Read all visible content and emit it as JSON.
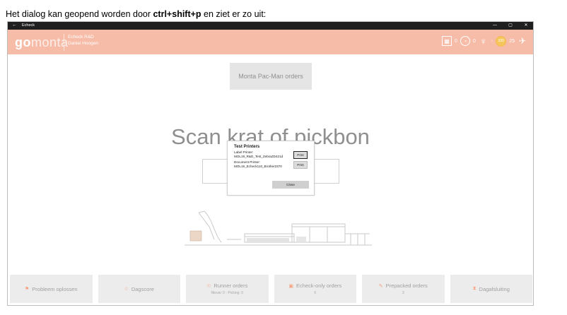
{
  "caption": {
    "prefix": "Het dialog kan geopend worden door ",
    "shortcut": "ctrl+shift+p",
    "suffix": " en ziet er zo uit:"
  },
  "window": {
    "title": "Echeck",
    "controls": [
      "—",
      "▢",
      "✕"
    ]
  },
  "header": {
    "logo_go": "go",
    "logo_monta": "monta",
    "company": "Echeck R&D",
    "user": "Daniel Hoogen",
    "stats": [
      {
        "icon": "calendar-icon",
        "value": "0"
      },
      {
        "icon": "clock-icon",
        "value": "0"
      },
      {
        "icon": "trophy-icon",
        "value": "-"
      },
      {
        "icon": "coin-icon",
        "value": "25"
      },
      {
        "icon": "runner-icon",
        "value": ""
      }
    ],
    "coin_label": "100"
  },
  "pacman_button": "Monta Pac-Man orders",
  "scan_title": "Scan krat of pickbon",
  "dialog": {
    "title": "Test Printers",
    "label_printer_caption": "Label Printer:",
    "label_printer_name": "MOL19_R&D_Test_ZebraZD421d",
    "document_printer_caption": "Document Printer:",
    "document_printer_name": "MOL19_Echeck110_Brother2370",
    "print_label": "Print",
    "close_label": "Close"
  },
  "tiles": [
    {
      "icon": "flag-icon",
      "glyph": "⚑",
      "label": "Probleem oplossen",
      "sub": ""
    },
    {
      "icon": "star-icon",
      "glyph": "☆",
      "label": "Dagscore",
      "sub": ""
    },
    {
      "icon": "runner-icon",
      "glyph": "☉",
      "label": "Runner orders",
      "sub": "Nieuw: 0 - Picking: 0"
    },
    {
      "icon": "box-icon",
      "glyph": "▣",
      "label": "Echeck-only orders",
      "sub": "6"
    },
    {
      "icon": "wand-icon",
      "glyph": "✎",
      "label": "Prepacked orders",
      "sub": "3"
    },
    {
      "icon": "hourglass-icon",
      "glyph": "⧗",
      "label": "Dagafsluiting",
      "sub": ""
    }
  ],
  "colors": {
    "header": "#f7bca8",
    "accent": "#f4a07e",
    "tile_bg": "#ececec"
  }
}
